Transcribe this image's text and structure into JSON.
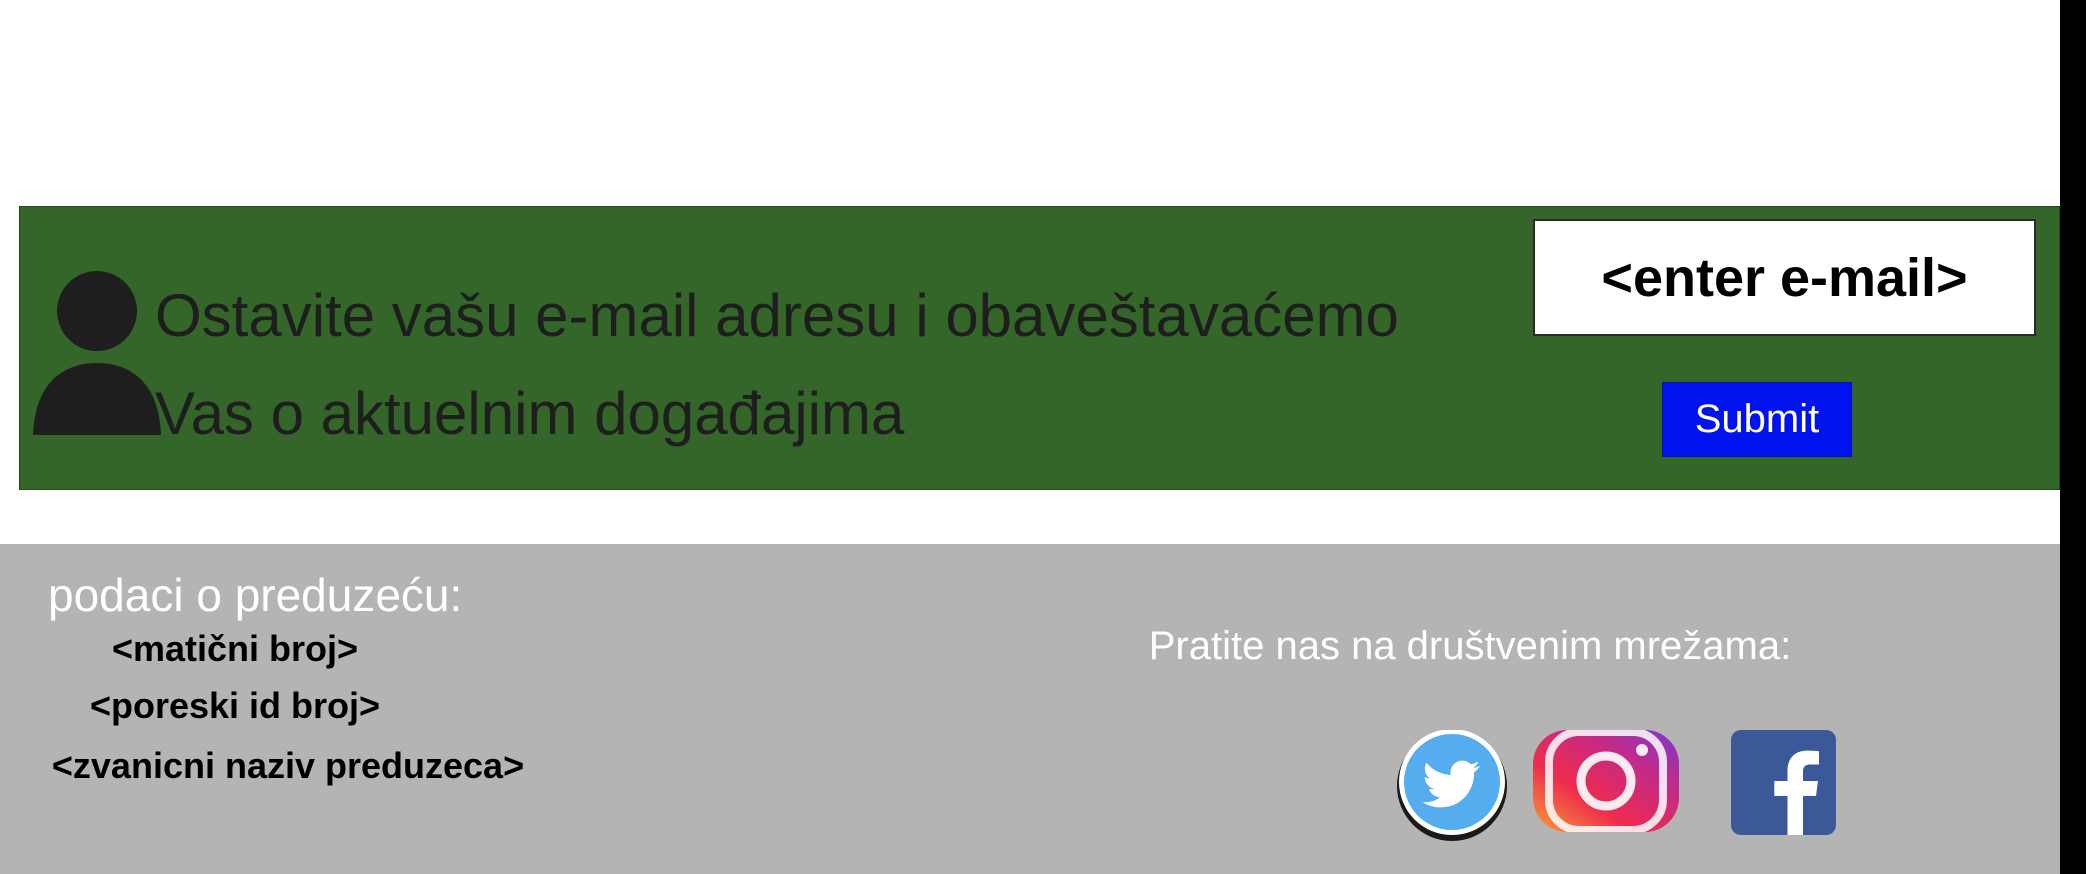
{
  "newsletter": {
    "line1": "Ostavite vašu e-mail adresu i obaveštavaćemo",
    "line2": "Vas o aktuelnim događajima",
    "email_placeholder": "<enter e-mail>",
    "submit_label": "Submit",
    "background": "#346629",
    "button_color": "#0012ee"
  },
  "footer": {
    "company_heading": "podaci o preduzeću:",
    "company_lines": [
      "<matični broj>",
      "<poreski id broj>",
      "<zvanicni naziv preduzeca>"
    ],
    "social_heading": "Pratite nas na društvenim mrežama:",
    "social_icons": [
      "twitter-icon",
      "instagram-icon",
      "facebook-icon"
    ],
    "background": "#b4b4b4"
  }
}
